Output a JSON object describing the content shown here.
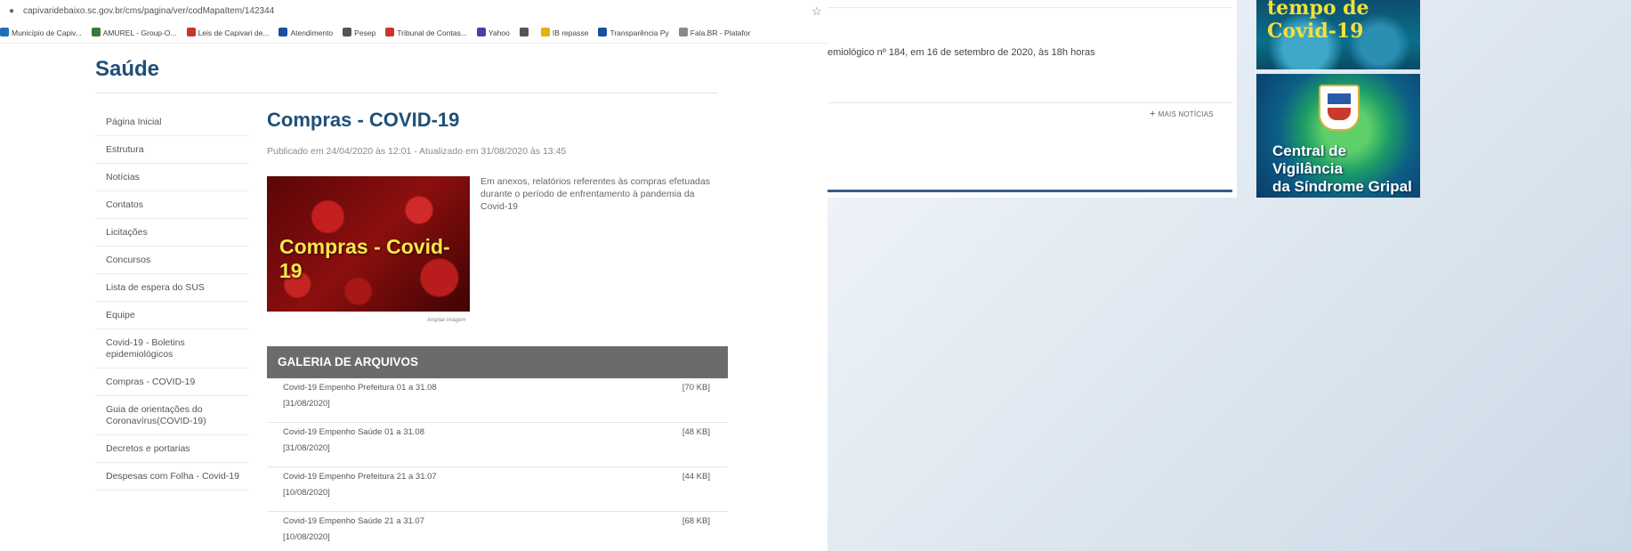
{
  "browser": {
    "url": "capivaridebaixo.sc.gov.br/cms/pagina/ver/codMapaItem/142344",
    "bookmarks": [
      {
        "label": "Município de Capiv...",
        "color": "#1c6fb8"
      },
      {
        "label": "AMUREL - Group-O...",
        "color": "#3a7a3a"
      },
      {
        "label": "Leis de Capivari de...",
        "color": "#c9372c"
      },
      {
        "label": "Atendimento",
        "color": "#1a4fa0"
      },
      {
        "label": "Pesep",
        "color": "#555555"
      },
      {
        "label": "Tribunal de Contas...",
        "color": "#c9372c"
      },
      {
        "label": "Yahoo",
        "color": "#4b3fa8"
      },
      {
        "label": "",
        "color": "#555555"
      },
      {
        "label": "IB repasse",
        "color": "#e0b30f"
      },
      {
        "label": "Transparência Py",
        "color": "#1a4fa0"
      },
      {
        "label": "Fala.BR - Platafor",
        "color": "#888888"
      }
    ]
  },
  "site": {
    "title": "Saúde"
  },
  "sidebar": {
    "items": [
      "Página Inicial",
      "Estrutura",
      "Notícias",
      "Contatos",
      "Licitações",
      "Concursos",
      "Lista de espera do SUS",
      "Equipe",
      "Covid-19 - Boletins epidemiológicos",
      "Compras - COVID-19",
      "Guia de orientações do Coronavírus(COVID-19)",
      "Decretos e portarias",
      "Despesas com Folha - Covid-19"
    ]
  },
  "article": {
    "heading": "Compras - COVID-19",
    "published": "Publicado em 24/04/2020 às 12:01 - Atualizado em 31/08/2020 às 13:45",
    "image_text": "Compras - Covid-19",
    "image_caption": "Ampliar imagem",
    "intro": "Em anexos, relatórios referentes às compras efetuadas durante o período de enfrentamento à pandemia da Covid-19"
  },
  "gallery": {
    "title": "GALERIA DE ARQUIVOS",
    "files": [
      {
        "name": "Covid-19 Empenho Prefeitura 01 a 31.08",
        "date": "[31/08/2020]",
        "size": "[70 KB]"
      },
      {
        "name": "Covid-19 Empenho Saúde 01 a 31.08",
        "date": "[31/08/2020]",
        "size": "[48 KB]"
      },
      {
        "name": "Covid-19 Empenho Prefeitura 21 a 31.07",
        "date": "[10/08/2020]",
        "size": "[44 KB]"
      },
      {
        "name": "Covid-19 Empenho Saúde 21 a 31.07",
        "date": "[10/08/2020]",
        "size": "[68 KB]"
      }
    ]
  },
  "news": {
    "snippet": "emiológico nº 184, em 16 de setembro de 2020, às 18h horas",
    "more_label": "MAIS NOTÍCIAS"
  },
  "banners": {
    "banner1": "tempo de Covid-19",
    "banner2_line1": "Central de Vigilância",
    "banner2_line2": "da Síndrome Gripal"
  }
}
